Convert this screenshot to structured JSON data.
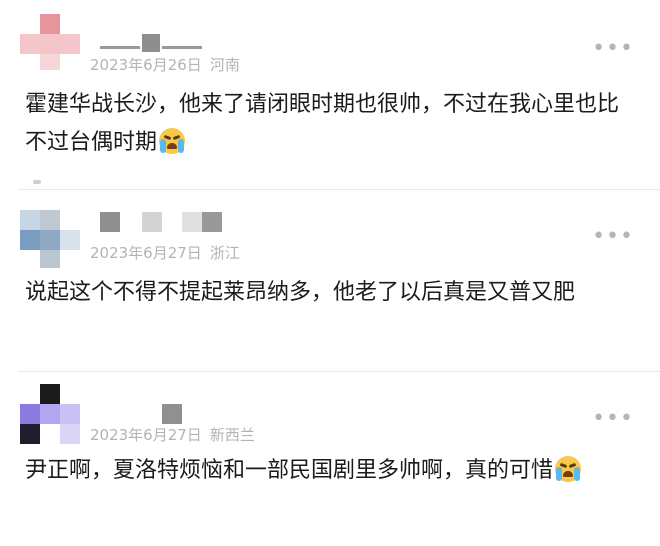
{
  "comments": [
    {
      "date": "2023年6月26日",
      "region": "河南",
      "text": "霍建华战长沙，他来了请闭眼时期也很帅，不过在我心里也比不过台偶时期",
      "emoji": "crying-face-icon",
      "more_label": "•••"
    },
    {
      "date": "2023年6月27日",
      "region": "浙江",
      "text": "说起这个不得不提起莱昂纳多，他老了以后真是又普又肥",
      "more_label": "•••"
    },
    {
      "date": "2023年6月27日",
      "region": "新西兰",
      "text": "尹正啊，夏洛特烦恼和一部民国剧里多帅啊，真的可惜",
      "emoji": "crying-face-icon",
      "more_label": "•••"
    }
  ]
}
